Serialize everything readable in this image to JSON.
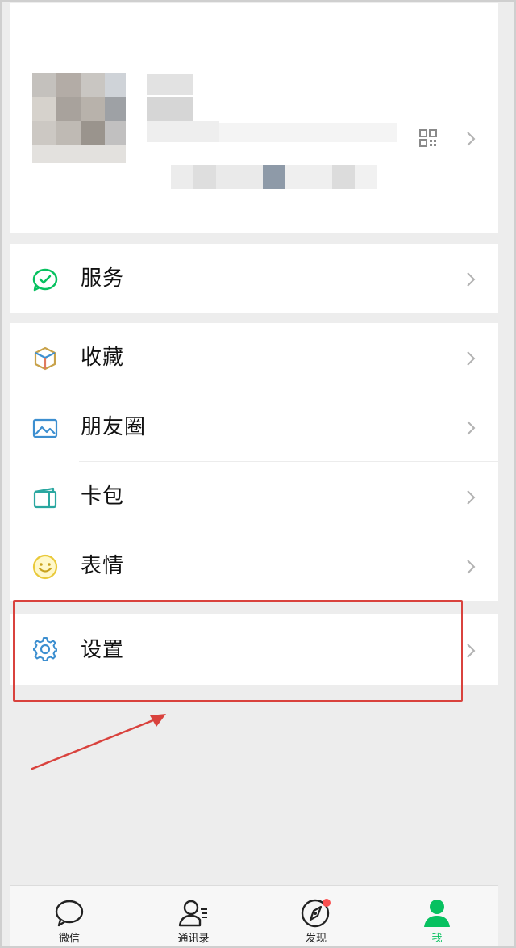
{
  "profile": {
    "avatar": "blurred-avatar",
    "name": "",
    "wechat_id": ""
  },
  "menu": {
    "services": "服务",
    "favorites": "收藏",
    "moments": "朋友圈",
    "cards": "卡包",
    "stickers": "表情",
    "settings": "设置"
  },
  "tabbar": {
    "chats": "微信",
    "contacts": "通讯录",
    "discover": "发现",
    "me": "我",
    "active": "me"
  },
  "colors": {
    "brand_green": "#07c160",
    "highlight_red": "#d9423d",
    "background": "#ededed",
    "notification_dot": "#fa5151"
  },
  "icons": {
    "services": "wallet-check-icon",
    "favorites": "cube-icon",
    "moments": "picture-icon",
    "cards": "card-wallet-icon",
    "stickers": "smiley-icon",
    "settings": "gear-icon"
  }
}
